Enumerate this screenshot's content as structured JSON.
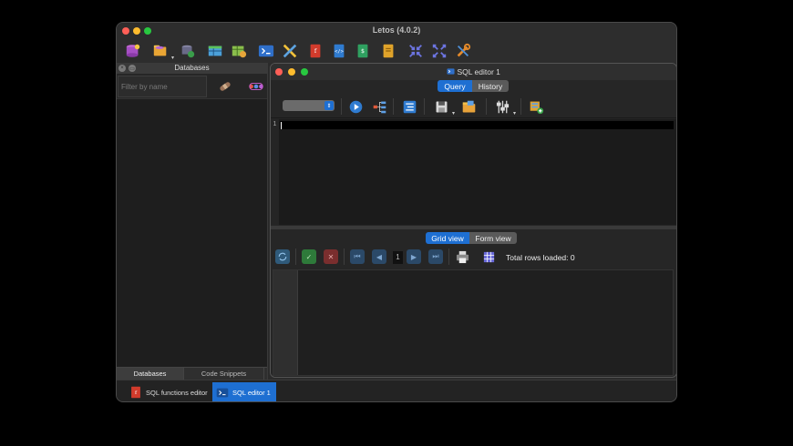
{
  "window": {
    "title": "Letos (4.0.2)"
  },
  "toolbar": {
    "buttons": [
      {
        "name": "database-add-icon"
      },
      {
        "name": "open-folder-icon"
      },
      {
        "name": "database-settings-icon"
      },
      {
        "name": "table-view-icon"
      },
      {
        "name": "table-add-icon"
      },
      {
        "name": "terminal-icon"
      },
      {
        "name": "tools-crossed-icon"
      },
      {
        "name": "pdf-function-icon"
      },
      {
        "name": "html-code-icon"
      },
      {
        "name": "script-icon"
      },
      {
        "name": "document-icon"
      },
      {
        "name": "collapse-arrows-icon"
      },
      {
        "name": "expand-arrows-icon"
      },
      {
        "name": "wrench-screwdriver-icon"
      }
    ]
  },
  "left_panel": {
    "title": "Databases",
    "filter_placeholder": "Filter by name",
    "tabs": [
      "Databases",
      "Code Snippets"
    ]
  },
  "sql_editor": {
    "title": "SQL editor 1",
    "tabs": [
      {
        "label": "Query",
        "active": true
      },
      {
        "label": "History",
        "active": false
      }
    ],
    "editor": {
      "line_numbers": [
        "1"
      ]
    },
    "result_tabs": [
      {
        "label": "Grid view",
        "active": true
      },
      {
        "label": "Form view",
        "active": false
      }
    ],
    "page_number": "1",
    "total_rows_label": "Total rows loaded: 0"
  },
  "bottom_tabs": [
    {
      "label": "SQL functions editor",
      "active": false
    },
    {
      "label": "SQL editor 1",
      "active": true
    }
  ],
  "colors": {
    "accent": "#1e6fd2",
    "window_bg": "#2b2b2b",
    "editor_bg": "#1b1b1b"
  }
}
